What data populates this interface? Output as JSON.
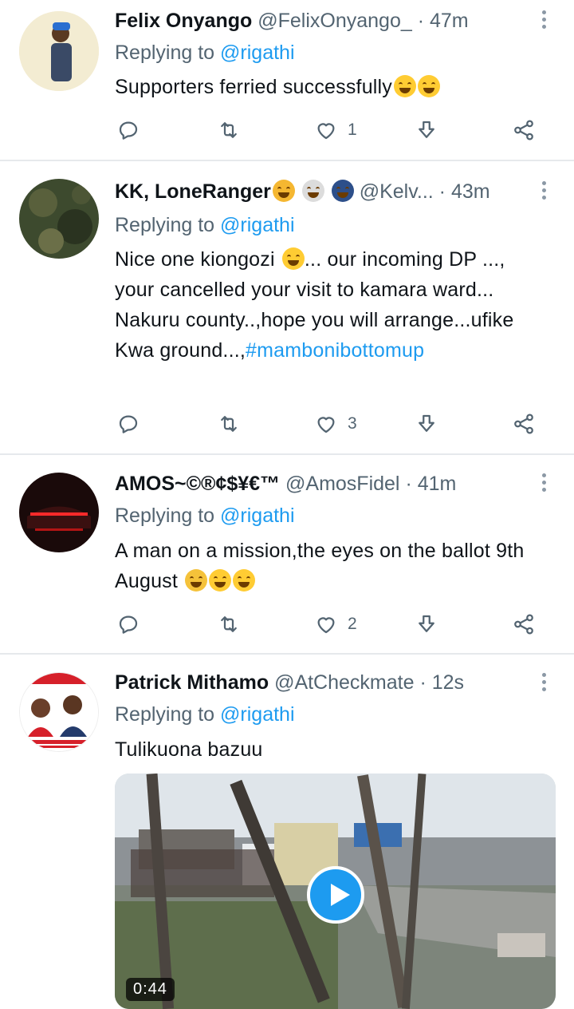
{
  "tweets": [
    {
      "name": "Felix Onyango",
      "handle": "@FelixOnyango_",
      "sep": "·",
      "time": "47m",
      "reply_prefix": "Replying to",
      "reply_to": "@rigathi",
      "text": "Supporters ferried successfully",
      "likes": "1",
      "avatar_bg": "#f3ecd2"
    },
    {
      "name": "KK, LoneRanger",
      "handle": "@Kelv...",
      "sep": "·",
      "time": "43m",
      "reply_prefix": "Replying to",
      "reply_to": "@rigathi",
      "text": "Nice one kiongozi",
      "text_cont": "... our incoming DP ..., your cancelled your visit to kamara ward... Nakuru county..,hope you will arrange...ufike Kwa ground...,",
      "hashtag": "#mambonibottomup",
      "likes": "3",
      "avatar_bg": "#3d4a2e"
    },
    {
      "name": "AMOS~©®¢$¥€™",
      "handle": "@AmosFidel",
      "sep": "·",
      "time": "41m",
      "reply_prefix": "Replying to",
      "reply_to": "@rigathi",
      "text": "A man on a mission,the eyes on the ballot 9th August",
      "likes": "2",
      "avatar_bg": "#1a0a0a"
    },
    {
      "name": "Patrick Mithamo",
      "handle": "@AtCheckmate",
      "sep": "·",
      "time": "12s",
      "reply_prefix": "Replying to",
      "reply_to": "@rigathi",
      "text": "Tulikuona bazuu",
      "video_duration": "0:44",
      "avatar_bg": "#ffffff"
    }
  ],
  "colors": {
    "accent": "#1d9bf0",
    "muted": "#536471",
    "divider": "#e6e9ec"
  },
  "icons": [
    "reply-icon",
    "retweet-icon",
    "like-icon",
    "bookmark-icon",
    "share-icon",
    "more-icon",
    "play-icon"
  ]
}
